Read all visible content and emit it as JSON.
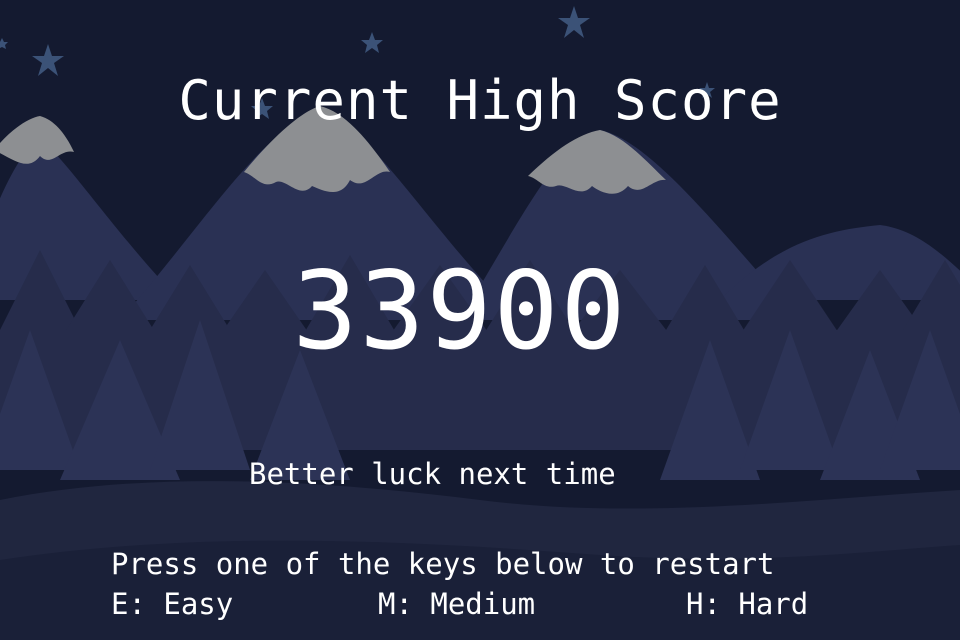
{
  "screen": {
    "title": "Current High Score",
    "score": "33900",
    "message": "Better luck next time",
    "prompt": "Press one of the keys below to restart",
    "options": [
      {
        "key": "E",
        "label": "E: Easy"
      },
      {
        "key": "M",
        "label": "M: Medium"
      },
      {
        "key": "H",
        "label": "H: Hard"
      }
    ]
  },
  "colors": {
    "sky": "#141a30",
    "far_mountain": "#2a3154",
    "snow": "#8d8f92",
    "tree_back": "#262c4b",
    "tree_front": "#2c3356",
    "ground": "#20263f",
    "star": "#3b5277",
    "text": "#ffffff"
  }
}
